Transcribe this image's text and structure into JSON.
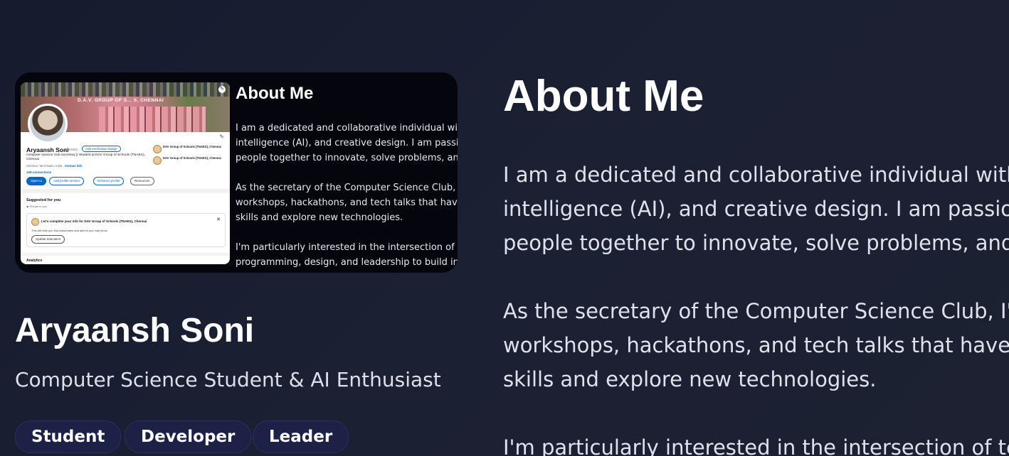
{
  "profile_screenshot": {
    "banner_text": "D.A.V. GROUP OF S... S, CHENNAI",
    "name": "Aryaansh Soni",
    "pronouns": "(He/Him)",
    "verify_badge": "Add verification badge",
    "headline": "computer science club secretary || Student at DAV Group of Schools (TNAES), Chennai",
    "location": "Chennai, Tamil Nadu, India · ",
    "contact_info": "Contact info",
    "connections": "128 connections",
    "orgs": [
      "DAV Group of Schools (TNAES), Chennai",
      "DAV Group of Schools (TNAES), Chennai"
    ],
    "buttons": [
      "Open to",
      "Add profile section",
      "Enhance profile",
      "Resources"
    ],
    "suggested_title": "Suggested for you",
    "private_label": "Private to you",
    "suggestion_title": "Let's complete your info for DAV Group of Schools (TNAES), Chennai",
    "suggestion_sub": "This will help you find classmates and alumni you may know.",
    "suggestion_button": "Update education",
    "analytics": "Analytics"
  },
  "card_about": {
    "title": "About Me",
    "para1": [
      "I am a dedicated and collaborative individual with",
      "intelligence (AI), and creative design. I am passion",
      "people together to innovate, solve problems, and"
    ],
    "para2": [
      "As the secretary of the Computer Science Club, I'",
      "workshops, hackathons, and tech talks that have",
      "skills and explore new technologies."
    ],
    "para3": [
      "I'm particularly interested in the intersection of te",
      "programming, design, and leadership to build inno"
    ]
  },
  "hero": {
    "name": "Aryaansh Soni",
    "tagline": "Computer Science Student & AI Enthusiast",
    "tags": [
      "Student",
      "Developer",
      "Leader"
    ]
  },
  "about": {
    "title": "About Me",
    "para1": [
      "I am a dedicated and collaborative individual with",
      "intelligence (AI), and creative design. I am passior",
      "people together to innovate, solve problems, and"
    ],
    "para2": [
      "As the secretary of the Computer Science Club, I'",
      "workshops, hackathons, and tech talks that have",
      "skills and explore new technologies."
    ],
    "para3": [
      "I'm particularly interested in the intersection of te"
    ]
  },
  "colors": {
    "background": "#1a1f31",
    "tag_bg": "#1c2145",
    "linkedin_blue": "#0a66c2"
  }
}
